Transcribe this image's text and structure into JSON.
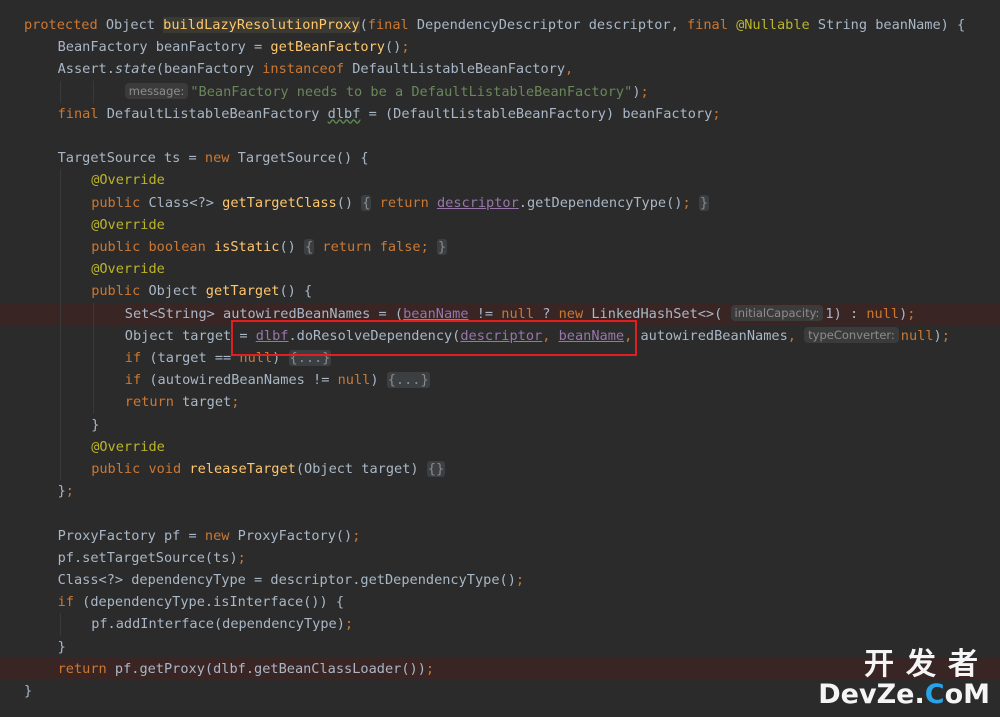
{
  "editor": {
    "language": "java",
    "lines": [
      {
        "indent": 0,
        "tokens": [
          {
            "t": "protected",
            "c": "kw"
          },
          {
            "t": " Object "
          },
          {
            "t": "buildLazyResolutionProxy",
            "c": "sig"
          },
          {
            "t": "("
          },
          {
            "t": "final",
            "c": "kw"
          },
          {
            "t": " DependencyDescriptor descriptor, "
          },
          {
            "t": "final",
            "c": "kw"
          },
          {
            "t": " "
          },
          {
            "t": "@Nullable",
            "c": "ann"
          },
          {
            "t": " String beanName) {"
          }
        ]
      },
      {
        "indent": 1,
        "tokens": [
          {
            "t": "BeanFactory beanFactory = "
          },
          {
            "t": "getBeanFactory",
            "c": "fn"
          },
          {
            "t": "()"
          },
          {
            "t": ";",
            "c": "kw"
          }
        ]
      },
      {
        "indent": 1,
        "tokens": [
          {
            "t": "Assert."
          },
          {
            "t": "state",
            "c": "ita"
          },
          {
            "t": "(beanFactory "
          },
          {
            "t": "instanceof",
            "c": "kw"
          },
          {
            "t": " DefaultListableBeanFactory"
          },
          {
            "t": ",",
            "c": "kw"
          }
        ]
      },
      {
        "indent": 3,
        "tokens": [
          {
            "t": "message:",
            "c": "hint"
          },
          {
            "t": "\"BeanFactory needs to be a DefaultListableBeanFactory\"",
            "c": "str"
          },
          {
            "t": ")"
          },
          {
            "t": ";",
            "c": "kw"
          }
        ]
      },
      {
        "indent": 1,
        "tokens": [
          {
            "t": "final",
            "c": "kw"
          },
          {
            "t": " DefaultListableBeanFactory "
          },
          {
            "t": "dlbf",
            "c": "wavy"
          },
          {
            "t": " = (DefaultListableBeanFactory) beanFactory"
          },
          {
            "t": ";",
            "c": "kw"
          }
        ]
      },
      {
        "indent": 0,
        "tokens": []
      },
      {
        "indent": 1,
        "tokens": [
          {
            "t": "TargetSource ts = "
          },
          {
            "t": "new",
            "c": "kw"
          },
          {
            "t": " TargetSource() {"
          }
        ]
      },
      {
        "indent": 2,
        "tokens": [
          {
            "t": "@Override",
            "c": "ann"
          }
        ]
      },
      {
        "indent": 2,
        "tokens": [
          {
            "t": "public",
            "c": "kw"
          },
          {
            "t": " Class<?> "
          },
          {
            "t": "getTargetClass",
            "c": "fn"
          },
          {
            "t": "() "
          },
          {
            "t": "{",
            "c": "fold"
          },
          {
            "t": " "
          },
          {
            "t": "return",
            "c": "kw"
          },
          {
            "t": " "
          },
          {
            "t": "descriptor",
            "c": "fld"
          },
          {
            "t": ".getDependencyType()"
          },
          {
            "t": ";",
            "c": "kw"
          },
          {
            "t": " "
          },
          {
            "t": "}",
            "c": "fold"
          }
        ]
      },
      {
        "indent": 2,
        "tokens": [
          {
            "t": "@Override",
            "c": "ann"
          }
        ]
      },
      {
        "indent": 2,
        "tokens": [
          {
            "t": "public",
            "c": "kw"
          },
          {
            "t": " "
          },
          {
            "t": "boolean",
            "c": "kw"
          },
          {
            "t": " "
          },
          {
            "t": "isStatic",
            "c": "fn"
          },
          {
            "t": "() "
          },
          {
            "t": "{",
            "c": "fold"
          },
          {
            "t": " "
          },
          {
            "t": "return",
            "c": "kw"
          },
          {
            "t": " "
          },
          {
            "t": "false",
            "c": "kw"
          },
          {
            "t": ";",
            "c": "kw"
          },
          {
            "t": " "
          },
          {
            "t": "}",
            "c": "fold"
          }
        ]
      },
      {
        "indent": 2,
        "tokens": [
          {
            "t": "@Override",
            "c": "ann"
          }
        ]
      },
      {
        "indent": 2,
        "tokens": [
          {
            "t": "public",
            "c": "kw"
          },
          {
            "t": " Object "
          },
          {
            "t": "getTarget",
            "c": "fn"
          },
          {
            "t": "() {"
          }
        ]
      },
      {
        "indent": 3,
        "highlight": true,
        "tokens": [
          {
            "t": "Set<String> autowiredBeanNames = ("
          },
          {
            "t": "beanName",
            "c": "fld"
          },
          {
            "t": " != "
          },
          {
            "t": "null",
            "c": "kw"
          },
          {
            "t": " ? "
          },
          {
            "t": "new",
            "c": "kw"
          },
          {
            "t": " LinkedHashSet<>( "
          },
          {
            "t": "initialCapacity:",
            "c": "hint"
          },
          {
            "t": "1) : "
          },
          {
            "t": "null",
            "c": "kw"
          },
          {
            "t": ")"
          },
          {
            "t": ";",
            "c": "kw"
          }
        ]
      },
      {
        "indent": 3,
        "tokens": [
          {
            "t": "Object target = "
          },
          {
            "t": "dlbf",
            "c": "fld"
          },
          {
            "t": ".doResolveDependency("
          },
          {
            "t": "descriptor",
            "c": "fld"
          },
          {
            "t": ", ",
            "c": "kw"
          },
          {
            "t": "beanName",
            "c": "fld"
          },
          {
            "t": ", ",
            "c": "kw"
          },
          {
            "t": "autowiredBeanNames"
          },
          {
            "t": ", ",
            "c": "kw"
          },
          {
            "t": "typeConverter:",
            "c": "hint"
          },
          {
            "t": "null",
            "c": "kw"
          },
          {
            "t": ")"
          },
          {
            "t": ";",
            "c": "kw"
          }
        ]
      },
      {
        "indent": 3,
        "tokens": [
          {
            "t": "if",
            "c": "kw"
          },
          {
            "t": " (target == "
          },
          {
            "t": "null",
            "c": "kw"
          },
          {
            "t": ") "
          },
          {
            "t": "{...}",
            "c": "fold"
          }
        ]
      },
      {
        "indent": 3,
        "tokens": [
          {
            "t": "if",
            "c": "kw"
          },
          {
            "t": " (autowiredBeanNames != "
          },
          {
            "t": "null",
            "c": "kw"
          },
          {
            "t": ") "
          },
          {
            "t": "{...}",
            "c": "fold"
          }
        ]
      },
      {
        "indent": 3,
        "tokens": [
          {
            "t": "return",
            "c": "kw"
          },
          {
            "t": " target"
          },
          {
            "t": ";",
            "c": "kw"
          }
        ]
      },
      {
        "indent": 2,
        "tokens": [
          {
            "t": "}"
          }
        ]
      },
      {
        "indent": 2,
        "tokens": [
          {
            "t": "@Override",
            "c": "ann"
          }
        ]
      },
      {
        "indent": 2,
        "tokens": [
          {
            "t": "public",
            "c": "kw"
          },
          {
            "t": " "
          },
          {
            "t": "void",
            "c": "kw"
          },
          {
            "t": " "
          },
          {
            "t": "releaseTarget",
            "c": "fn"
          },
          {
            "t": "(Object target) "
          },
          {
            "t": "{}",
            "c": "fold"
          }
        ]
      },
      {
        "indent": 1,
        "tokens": [
          {
            "t": "}"
          },
          {
            "t": ";",
            "c": "kw"
          }
        ]
      },
      {
        "indent": 0,
        "tokens": []
      },
      {
        "indent": 1,
        "tokens": [
          {
            "t": "ProxyFactory pf = "
          },
          {
            "t": "new",
            "c": "kw"
          },
          {
            "t": " ProxyFactory()"
          },
          {
            "t": ";",
            "c": "kw"
          }
        ]
      },
      {
        "indent": 1,
        "tokens": [
          {
            "t": "pf.setTargetSource(ts)"
          },
          {
            "t": ";",
            "c": "kw"
          }
        ]
      },
      {
        "indent": 1,
        "tokens": [
          {
            "t": "Class<?> dependencyType = descriptor.getDependencyType()"
          },
          {
            "t": ";",
            "c": "kw"
          }
        ]
      },
      {
        "indent": 1,
        "tokens": [
          {
            "t": "if",
            "c": "kw"
          },
          {
            "t": " (dependencyType.isInterface()) {"
          }
        ]
      },
      {
        "indent": 2,
        "tokens": [
          {
            "t": "pf.addInterface(dependencyType)"
          },
          {
            "t": ";",
            "c": "kw"
          }
        ]
      },
      {
        "indent": 1,
        "tokens": [
          {
            "t": "}"
          }
        ]
      },
      {
        "indent": 1,
        "highlight": true,
        "tokens": [
          {
            "t": "return",
            "c": "kw"
          },
          {
            "t": " pf.getProxy(dlbf.getBeanClassLoader())"
          },
          {
            "t": ";",
            "c": "kw"
          }
        ]
      },
      {
        "indent": 0,
        "tokens": [
          {
            "t": "}"
          }
        ]
      }
    ]
  },
  "watermark": {
    "cn": "开发者",
    "en_a": "DevZe.",
    "en_b": "C",
    "en_c": "oM"
  },
  "colors": {
    "background": "#2b2b2b",
    "keyword": "#cc7832",
    "method": "#ffc66d",
    "string": "#6a8759",
    "annotation": "#bbb529",
    "field": "#9876aa",
    "selection_box": "#e02020"
  }
}
